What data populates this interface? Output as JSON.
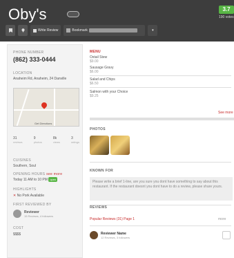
{
  "header": {
    "title": "Oby's",
    "rating": "3.7",
    "votes": "190 votes"
  },
  "toolbar": {
    "write_review_label": "Write Review",
    "bookmark_label": "Bookmark"
  },
  "sidebar": {
    "phone_label": "PHONE NUMBER",
    "phone": "(862) 333-0444",
    "location_label": "LOCATION",
    "address": "Anaheim Rd, Anaheim, 24 Danville",
    "map_caption": "Get Directions",
    "stats": [
      {
        "value": "31",
        "label": "reviews"
      },
      {
        "value": "9",
        "label": "photos"
      },
      {
        "value": "8k",
        "label": "views"
      },
      {
        "value": "3",
        "label": "ratings"
      }
    ],
    "cuisines_label": "CUISINES",
    "cuisines": "Southern, Soul",
    "opening_label": "OPENING HOURS",
    "opening_link": "see more",
    "opening_hours": "Today 11 AM to 10 PM",
    "open_badge": "open",
    "highlights_label": "HIGHLIGHTS",
    "highlight_item": "No Pork Available",
    "reviewer_label": "FIRST REVIEWED BY",
    "reviewer_name": "Reviewer",
    "reviewer_sub": "15 Reviews, 4 followers",
    "cost_label": "COST",
    "cost": "$$$$"
  },
  "main": {
    "menu_title": "MENU",
    "menu_items": [
      {
        "name": "Oxtail Stew",
        "price": "$9.00"
      },
      {
        "name": "Sausage Gravy",
        "price": "$6.00"
      },
      {
        "name": "Salad and Chips",
        "price": "$6.50"
      },
      {
        "name": "Salmon with your Choice",
        "price": "$9.25"
      }
    ],
    "menu_more": "See more",
    "photos_title": "PHOTOS",
    "known_title": "KNOWN FOR",
    "known_text": "Please write a brief 1-line, are you sure you dont have something to say about this restaurant. If the restaurant doesnt you dont have to do a review, please share yours.",
    "reviews_title": "REVIEWS",
    "reviews_tabs": "Popular Reviews (31)   Page 1",
    "reviews_more": "more",
    "reviewer_name": "Reviewer Name",
    "reviewer_sub": "12 Reviews, 3 followers"
  }
}
